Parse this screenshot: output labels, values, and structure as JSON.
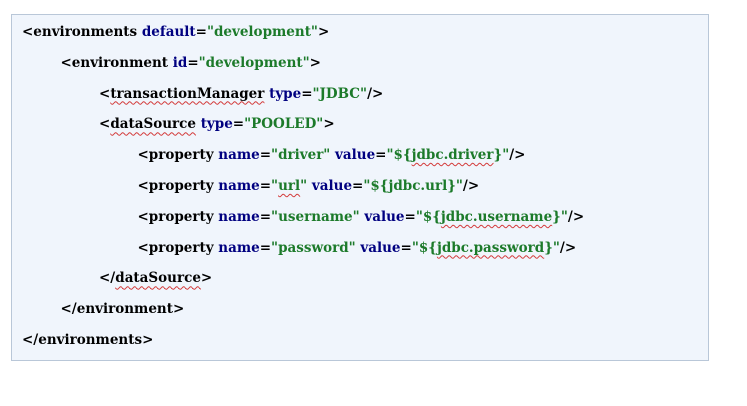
{
  "code": {
    "lines": [
      {
        "indent": 0,
        "parts": [
          {
            "text": "<environments ",
            "kind": "tag"
          },
          {
            "text": "default",
            "kind": "attr"
          },
          {
            "text": "=",
            "kind": "tag"
          },
          {
            "text": "\"development\"",
            "kind": "val"
          },
          {
            "text": ">",
            "kind": "tag"
          }
        ]
      },
      {
        "indent": 1,
        "parts": [
          {
            "text": "<environment ",
            "kind": "tag"
          },
          {
            "text": "id",
            "kind": "attr"
          },
          {
            "text": "=",
            "kind": "tag"
          },
          {
            "text": "\"development\"",
            "kind": "val"
          },
          {
            "text": ">",
            "kind": "tag"
          }
        ]
      },
      {
        "indent": 2,
        "parts": [
          {
            "text": "<",
            "kind": "tag"
          },
          {
            "text": "transactionManager",
            "kind": "tag",
            "squiggle": true
          },
          {
            "text": " ",
            "kind": "tag"
          },
          {
            "text": "type",
            "kind": "attr"
          },
          {
            "text": "=",
            "kind": "tag"
          },
          {
            "text": "\"JDBC\"",
            "kind": "val"
          },
          {
            "text": "/>",
            "kind": "tag"
          }
        ]
      },
      {
        "indent": 2,
        "parts": [
          {
            "text": "<",
            "kind": "tag"
          },
          {
            "text": "dataSource",
            "kind": "tag",
            "squiggle": true
          },
          {
            "text": " ",
            "kind": "tag"
          },
          {
            "text": "type",
            "kind": "attr"
          },
          {
            "text": "=",
            "kind": "tag"
          },
          {
            "text": "\"POOLED\"",
            "kind": "val"
          },
          {
            "text": ">",
            "kind": "tag"
          }
        ]
      },
      {
        "indent": 3,
        "parts": [
          {
            "text": "<property ",
            "kind": "tag"
          },
          {
            "text": "name",
            "kind": "attr"
          },
          {
            "text": "=",
            "kind": "tag"
          },
          {
            "text": "\"driver\"",
            "kind": "val"
          },
          {
            "text": " ",
            "kind": "tag"
          },
          {
            "text": "value",
            "kind": "attr"
          },
          {
            "text": "=",
            "kind": "tag"
          },
          {
            "text": "\"${",
            "kind": "val"
          },
          {
            "text": "jdbc.driver",
            "kind": "val",
            "squiggle": true
          },
          {
            "text": "}\"",
            "kind": "val"
          },
          {
            "text": "/>",
            "kind": "tag"
          }
        ]
      },
      {
        "indent": 3,
        "parts": [
          {
            "text": "<property ",
            "kind": "tag"
          },
          {
            "text": "name",
            "kind": "attr"
          },
          {
            "text": "=",
            "kind": "tag"
          },
          {
            "text": "\"",
            "kind": "val"
          },
          {
            "text": "url",
            "kind": "val",
            "squiggle": true
          },
          {
            "text": "\"",
            "kind": "val"
          },
          {
            "text": " ",
            "kind": "tag"
          },
          {
            "text": "value",
            "kind": "attr"
          },
          {
            "text": "=",
            "kind": "tag"
          },
          {
            "text": "\"${jdbc.url}\"",
            "kind": "val"
          },
          {
            "text": "/>",
            "kind": "tag"
          }
        ]
      },
      {
        "indent": 3,
        "parts": [
          {
            "text": "<property ",
            "kind": "tag"
          },
          {
            "text": "name",
            "kind": "attr"
          },
          {
            "text": "=",
            "kind": "tag"
          },
          {
            "text": "\"username\"",
            "kind": "val"
          },
          {
            "text": " ",
            "kind": "tag"
          },
          {
            "text": "value",
            "kind": "attr"
          },
          {
            "text": "=",
            "kind": "tag"
          },
          {
            "text": "\"${",
            "kind": "val"
          },
          {
            "text": "jdbc.username",
            "kind": "val",
            "squiggle": true
          },
          {
            "text": "}\"",
            "kind": "val"
          },
          {
            "text": "/>",
            "kind": "tag"
          }
        ]
      },
      {
        "indent": 3,
        "parts": [
          {
            "text": "<property ",
            "kind": "tag"
          },
          {
            "text": "name",
            "kind": "attr"
          },
          {
            "text": "=",
            "kind": "tag"
          },
          {
            "text": "\"password\"",
            "kind": "val"
          },
          {
            "text": " ",
            "kind": "tag"
          },
          {
            "text": "value",
            "kind": "attr"
          },
          {
            "text": "=",
            "kind": "tag"
          },
          {
            "text": "\"${",
            "kind": "val"
          },
          {
            "text": "jdbc.password",
            "kind": "val",
            "squiggle": true
          },
          {
            "text": "}\"",
            "kind": "val"
          },
          {
            "text": "/>",
            "kind": "tag"
          }
        ]
      },
      {
        "indent": 2,
        "parts": [
          {
            "text": "</",
            "kind": "tag"
          },
          {
            "text": "dataSource",
            "kind": "tag",
            "squiggle": true
          },
          {
            "text": ">",
            "kind": "tag"
          }
        ]
      },
      {
        "indent": 1,
        "parts": [
          {
            "text": "</environment>",
            "kind": "tag"
          }
        ]
      },
      {
        "indent": 0,
        "parts": [
          {
            "text": "</environments>",
            "kind": "tag"
          }
        ]
      }
    ]
  },
  "colors": {
    "tag": "#000000",
    "attr": "#000080",
    "val": "#1c7a2a",
    "background": "#f0f5fc",
    "border": "#b9c7d8",
    "squiggle": "#d33a3a"
  }
}
